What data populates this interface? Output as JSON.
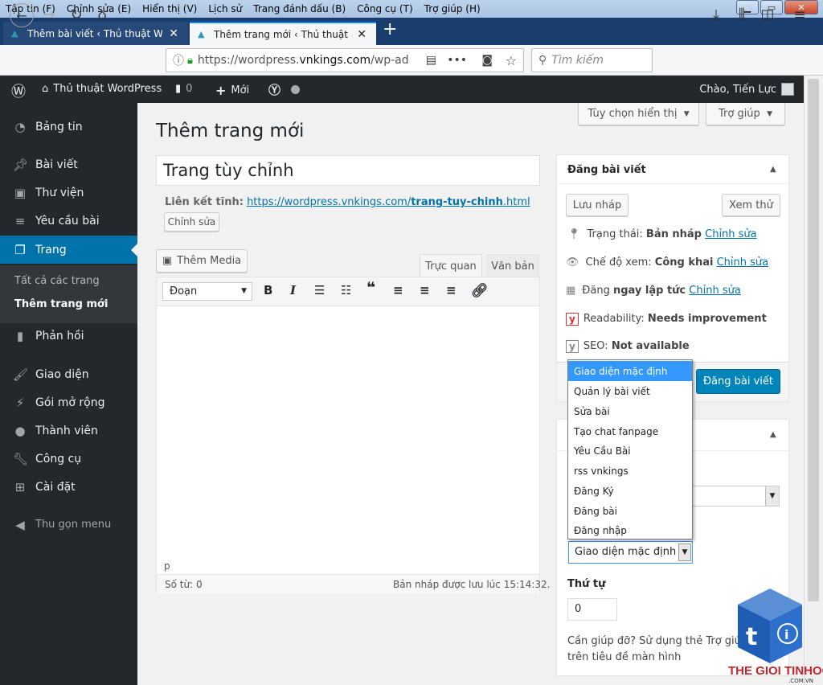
{
  "menubar": [
    "Tập tin (F)",
    "Chỉnh sửa (E)",
    "Hiển thị (V)",
    "Lịch sử",
    "Trang đánh dấu (B)",
    "Công cụ (T)",
    "Trợ giúp (H)"
  ],
  "tabs": [
    {
      "label": "Thêm bài viết ‹ Thủ thuật WordPress",
      "close": "✕"
    },
    {
      "label": "Thêm trang mới ‹ Thủ thuật WordPress",
      "close": "✕"
    }
  ],
  "url": {
    "prefix": "https://wordpress.",
    "domain": "vnkings.com",
    "suffix": "/wp-ad"
  },
  "search_placeholder": "Tìm kiếm",
  "adminbar": {
    "site": "Thủ thuật WordPress",
    "comments": "0",
    "new": "Mới",
    "greeting": "Chào, Tiến Lực"
  },
  "sidebar": {
    "items": [
      "Bảng tin",
      "Bài viết",
      "Thư viện",
      "Yêu cầu bài",
      "Trang",
      "Phản hồi",
      "Giao diện",
      "Gói mở rộng",
      "Thành viên",
      "Công cụ",
      "Cài đặt",
      "Thu gọn menu"
    ],
    "sub": [
      "Tất cả các trang",
      "Thêm trang mới"
    ]
  },
  "screen_options": "Tùy chọn hiển thị",
  "help": "Trợ giúp",
  "page_title": "Thêm trang mới",
  "post_title": "Trang tùy chỉnh",
  "permalink": {
    "label": "Liên kết tĩnh:",
    "url_prefix": "https://wordpress.vnkings.com/",
    "slug": "trang-tuy-chinh",
    "url_suffix": ".html",
    "edit": "Chỉnh sửa"
  },
  "editor": {
    "add_media": "Thêm Media",
    "tab_visual": "Trực quan",
    "tab_text": "Văn bản",
    "format": "Đoạn",
    "path": "p",
    "word_count": "Số từ: 0",
    "saved": "Bản nháp được lưu lúc 15:14:32."
  },
  "publish": {
    "title": "Đăng bài viết",
    "save_draft": "Lưu nháp",
    "preview": "Xem thử",
    "status_label": "Trạng thái:",
    "status_value": "Bản nháp",
    "visibility_label": "Chế độ xem:",
    "visibility_value": "Công khai",
    "publish_label": "Đăng",
    "publish_value": "ngay lập tức",
    "edit": "Chỉnh sửa",
    "readability_label": "Readability:",
    "readability_value": "Needs improvement",
    "seo_label": "SEO:",
    "seo_value": "Not available",
    "publish_button": "Đăng bài viết"
  },
  "template_options": [
    "Giao diện mặc định",
    "Quản lý bài viết",
    "Sửa bài",
    "Tạo chat fanpage",
    "Yêu Cầu Bài",
    "rss vnkings",
    "Đăng Ký",
    "Đăng bài",
    "Đăng nhập"
  ],
  "template_selected": "Giao diện mặc định",
  "order_label": "Thứ tự",
  "order_value": "0",
  "help_text": "Cần giúp đỡ? Sử dụng thẻ Trợ giúp ở trên tiêu đề màn hình",
  "logo_text": "THE GIOI TINHOC",
  "logo_sub": ".COM.VN",
  "colors": {
    "wp_blue": "#0073aa",
    "admin_dark": "#23282d",
    "publish_btn": "#0085ba",
    "dropdown_sel": "#3399ff"
  }
}
